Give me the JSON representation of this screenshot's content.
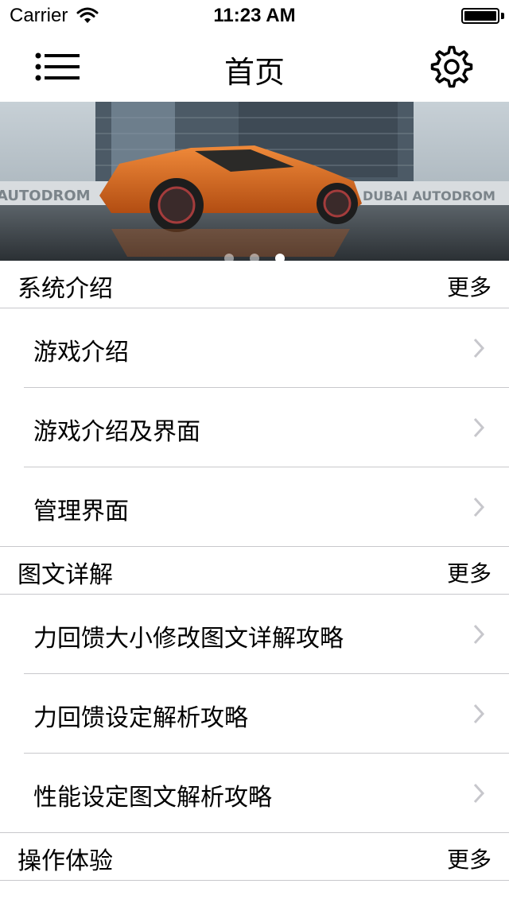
{
  "status": {
    "carrier": "Carrier",
    "time": "11:23 AM"
  },
  "nav": {
    "title": "首页"
  },
  "banner": {
    "signs": [
      "AUTODROM",
      "DUBAI AUTODROM"
    ],
    "pages": 3,
    "active_page": 3
  },
  "sections": [
    {
      "title": "系统介绍",
      "more": "更多",
      "items": [
        "游戏介绍",
        "游戏介绍及界面",
        "管理界面"
      ]
    },
    {
      "title": "图文详解",
      "more": "更多",
      "items": [
        "力回馈大小修改图文详解攻略",
        "力回馈设定解析攻略",
        "性能设定图文解析攻略"
      ]
    },
    {
      "title": "操作体验",
      "more": "更多",
      "items": []
    }
  ]
}
